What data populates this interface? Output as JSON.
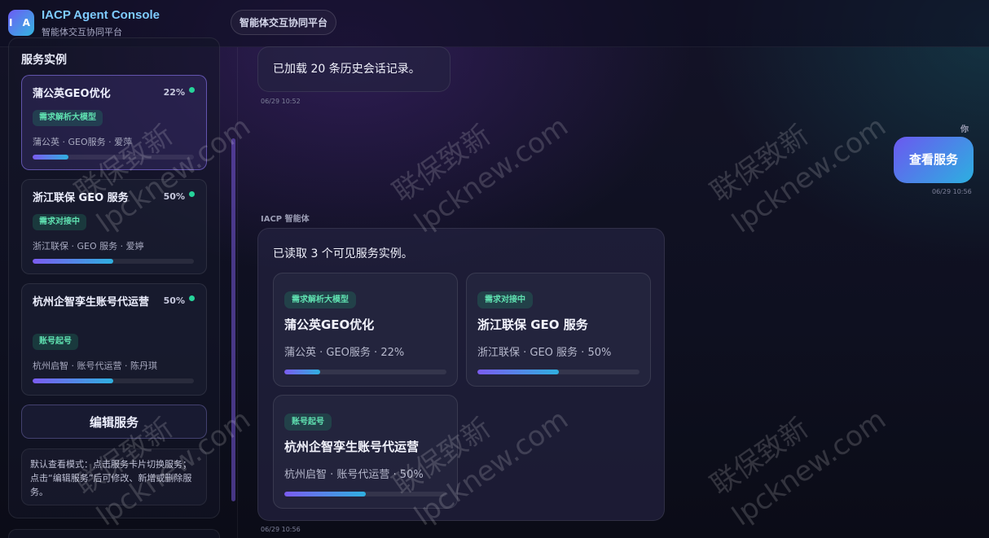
{
  "header": {
    "logo_text": "I A",
    "title": "IACP Agent Console",
    "subtitle": "智能体交互协同平台",
    "pill": "智能体交互协同平台"
  },
  "sidebar": {
    "title": "服务实例",
    "instances": [
      {
        "name": "蒲公英GEO优化",
        "percent": "22%",
        "progress": 0.22,
        "tag": "需求解析大模型",
        "meta": "蒲公英 · GEO服务 · 爱萍",
        "active": true
      },
      {
        "name": "浙江联保 GEO 服务",
        "percent": "50%",
        "progress": 0.5,
        "tag": "需求对接中",
        "meta": "浙江联保 · GEO 服务 · 爱婷",
        "active": false
      },
      {
        "name": "杭州企智孪生账号代运营",
        "percent": "50%",
        "progress": 0.5,
        "tag": "账号起号",
        "meta": "杭州启智 · 账号代运营 · 陈丹琪",
        "active": false
      }
    ],
    "edit_button": "编辑服务",
    "hint": "默认查看模式：点击服务卡片切换服务；点击“编辑服务”后可修改、新增或删除服务。"
  },
  "chat": {
    "messages": [
      {
        "text": "已加载 20 条历史会话记录。",
        "time": "06/29 10:52"
      },
      {
        "sender": "你",
        "text": "查看服务",
        "time": "06/29 10:56"
      },
      {
        "sender": "IACP 智能体",
        "text": "已读取 3 个可见服务实例。",
        "time": "06/29 10:56"
      }
    ],
    "service_cards": [
      {
        "tag": "需求解析大模型",
        "name": "蒲公英GEO优化",
        "meta": "蒲公英 · GEO服务 · 22%",
        "progress": 0.22
      },
      {
        "tag": "需求对接中",
        "name": "浙江联保 GEO 服务",
        "meta": "浙江联保 · GEO 服务 · 50%",
        "progress": 0.5
      },
      {
        "tag": "账号起号",
        "name": "杭州企智孪生账号代运营",
        "meta": "杭州启智 · 账号代运营 · 50%",
        "progress": 0.5
      }
    ]
  },
  "watermark": {
    "line1": "联保致新",
    "line2": "lpcknew.com"
  },
  "colors": {
    "accent": "#6b58f0",
    "accent2": "#2cb0e0",
    "tag_green": "#5fe0b0",
    "status_dot": "#26d39a"
  }
}
